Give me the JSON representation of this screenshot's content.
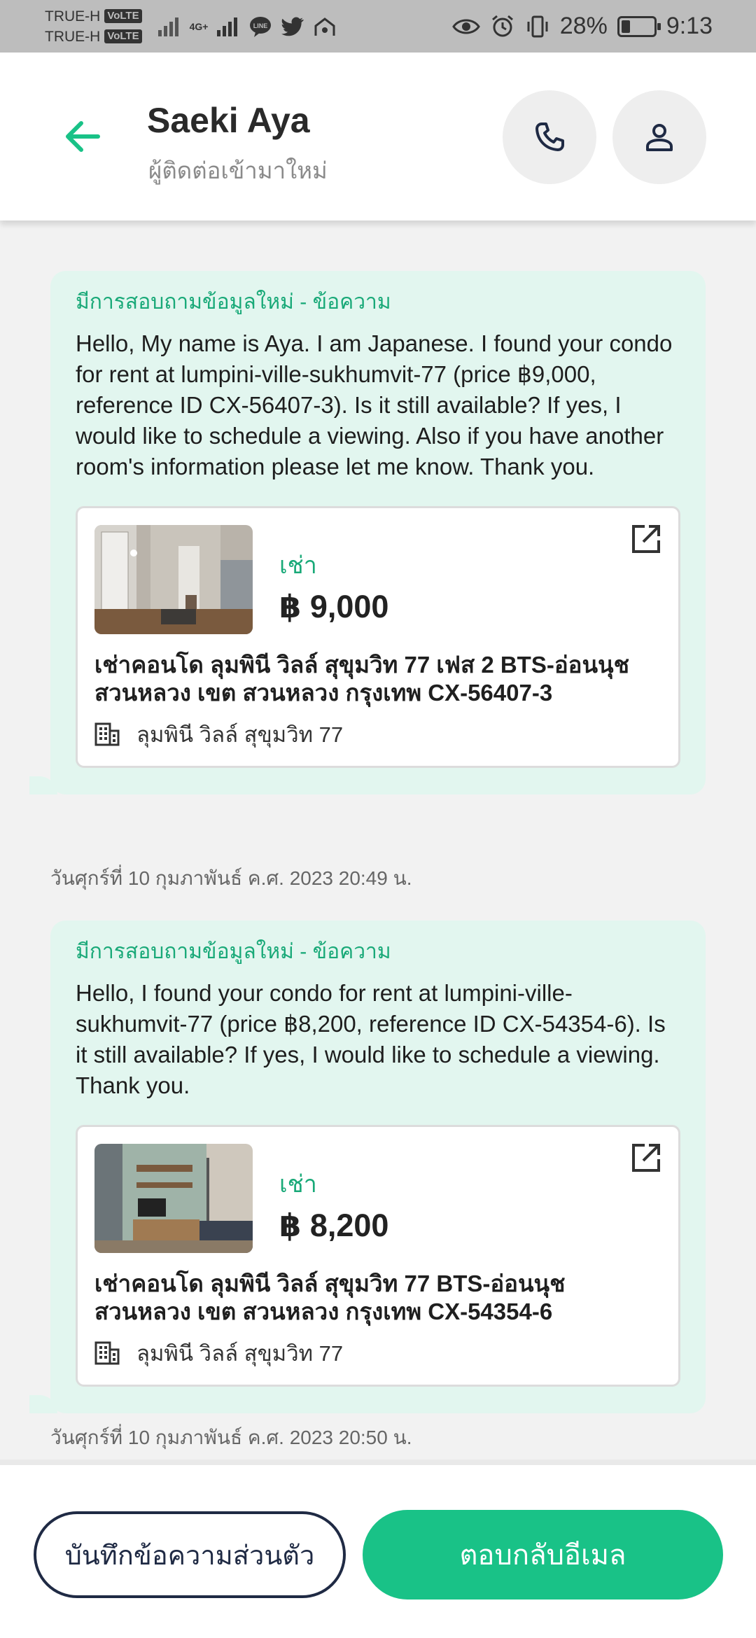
{
  "status_bar": {
    "carrier1": "TRUE-H",
    "carrier2": "TRUE-H",
    "volte": "VoLTE",
    "network": "4G+",
    "battery_percent": "28%",
    "battery_level": 0.28,
    "time": "9:13"
  },
  "header": {
    "contact_name": "Saeki Aya",
    "contact_subtitle": "ผู้ติดต่อเข้ามาใหม่"
  },
  "messages": [
    {
      "title": "มีการสอบถามข้อมูลใหม่ - ข้อความ",
      "text": "Hello, My name is Aya. I am Japanese. I found your condo for rent at lumpini-ville-sukhumvit-77 (price ฿9,000, reference ID CX-56407-3). Is it still available? If yes, I would like to schedule a viewing. Also if you have another room's information please let me know. Thank you.",
      "listing": {
        "type_label": "เช่า",
        "price": "฿ 9,000",
        "title": "เช่าคอนโด  ลุมพินี วิลล์ สุขุมวิท 77 เฟส 2 BTS-อ่อนนุช สวนหลวง เขต สวนหลวง กรุงเทพ CX-56407-3",
        "project": "ลุมพินี วิลล์ สุขุมวิท 77"
      },
      "timestamp": "วันศุกร์ที่ 10 กุมภาพันธ์ ค.ศ. 2023 20:49 น."
    },
    {
      "title": "มีการสอบถามข้อมูลใหม่ - ข้อความ",
      "text": "Hello, I found your condo for rent at lumpini-ville-sukhumvit-77 (price ฿8,200, reference ID CX-54354-6). Is it still available? If yes, I would like to schedule a viewing. Thank you.",
      "listing": {
        "type_label": "เช่า",
        "price": "฿ 8,200",
        "title": "เช่าคอนโด  ลุมพินี วิลล์ สุขุมวิท 77 BTS-อ่อนนุช สวนหลวง เขต สวนหลวง กรุงเทพ CX-54354-6",
        "project": "ลุมพินี วิลล์ สุขุมวิท 77"
      },
      "timestamp": "วันศุกร์ที่ 10 กุมภาพันธ์ ค.ศ. 2023 20:50 น."
    }
  ],
  "actions": {
    "note_label": "บันทึกข้อความส่วนตัว",
    "reply_label": "ตอบกลับอีเมล"
  },
  "colors": {
    "accent": "#19c287",
    "accent_text": "#19a978",
    "bubble_bg": "#e2f6ef"
  },
  "icons": {
    "back": "arrow-left-icon",
    "call": "phone-icon",
    "profile": "person-icon",
    "external": "external-link-icon",
    "building": "building-icon"
  }
}
